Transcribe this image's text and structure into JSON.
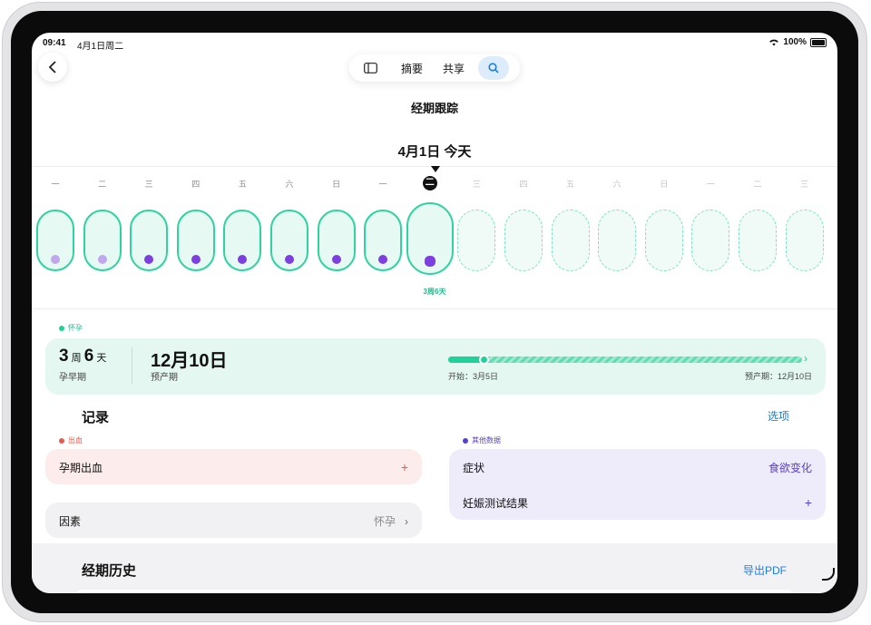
{
  "status_bar": {
    "time": "09:41",
    "date": "4月1日周二",
    "battery": "100%"
  },
  "toolbar": {
    "back_icon": "chevron-left-icon",
    "sidebar_icon": "sidebar-icon",
    "tab_summary": "摘要",
    "tab_share": "共享",
    "search_icon": "search-icon"
  },
  "nav": {
    "title": "经期跟踪"
  },
  "calendar": {
    "today_header": "4月1日 今天",
    "today_letter": "二",
    "week_label": "3周6天",
    "days": [
      {
        "label": "一",
        "dot": "light",
        "state": "past"
      },
      {
        "label": "二",
        "dot": "light",
        "state": "past"
      },
      {
        "label": "三",
        "dot": "dark",
        "state": "past"
      },
      {
        "label": "四",
        "dot": "dark",
        "state": "past"
      },
      {
        "label": "五",
        "dot": "dark",
        "state": "past"
      },
      {
        "label": "六",
        "dot": "dark",
        "state": "past"
      },
      {
        "label": "日",
        "dot": "dark",
        "state": "past"
      },
      {
        "label": "一",
        "dot": "dark",
        "state": "past"
      },
      {
        "label": "二",
        "dot": "dark",
        "state": "today"
      },
      {
        "label": "三",
        "dot": "",
        "state": "future"
      },
      {
        "label": "四",
        "dot": "",
        "state": "future"
      },
      {
        "label": "五",
        "dot": "",
        "state": "future"
      },
      {
        "label": "六",
        "dot": "",
        "state": "future"
      },
      {
        "label": "日",
        "dot": "",
        "state": "future"
      },
      {
        "label": "一",
        "dot": "",
        "state": "future"
      },
      {
        "label": "二",
        "dot": "",
        "state": "future"
      },
      {
        "label": "三",
        "dot": "",
        "state": "future"
      }
    ]
  },
  "pregnancy": {
    "tag": "怀孕",
    "weeks": "3",
    "weeks_unit": "周",
    "days": "6",
    "days_unit": "天",
    "phase": "孕早期",
    "due_date": "12月10日",
    "due_label": "预产期",
    "start_text": "开始：3月5日",
    "end_text": "预产期：12月10日",
    "progress": 0.1
  },
  "records": {
    "title": "记录",
    "options": "选项",
    "bleeding_tag": "出血",
    "bleeding_item": "孕期出血",
    "factors_label": "因素",
    "factors_value": "怀孕",
    "other_tag": "其他数据",
    "symptoms_label": "症状",
    "symptoms_value": "食欲变化",
    "hcg_label": "妊娠测试结果"
  },
  "history": {
    "title": "经期历史",
    "export": "导出PDF"
  },
  "colors": {
    "accent_green": "#1fd19a",
    "accent_blue": "#1a7fe0",
    "purple": "#5a3fcf",
    "red": "#e85a4f"
  }
}
